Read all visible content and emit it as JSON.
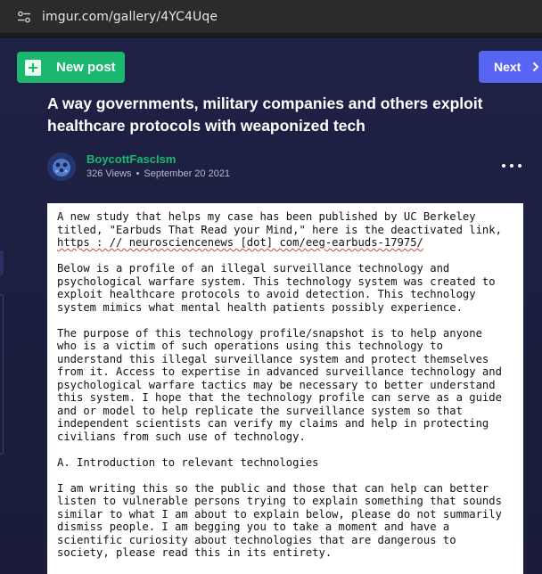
{
  "browser": {
    "url": "imgur.com/gallery/4YC4Uqe",
    "site_icon": "site-settings-icon"
  },
  "toolbar": {
    "new_post_label": "New post",
    "new_post_icon": "plus-icon",
    "next_label": "Next",
    "next_icon": "chevron-right-icon"
  },
  "post": {
    "title": "A way governments, military companies and others exploit healthcare protocols with weaponized tech",
    "author": "BoycottFascIsm",
    "views": "326 Views",
    "date": "September 20 2021",
    "more_icon": "more-options-icon"
  },
  "document": {
    "lines": [
      [
        "A new study that helps my case has been published by UC Berkeley",
        "titled, \"Earbuds That Read your Mind,\" here is the deactivated link,",
        "https : // neurosciencenews [dot] com/eeg-earbuds-17975/"
      ],
      [
        "Below is a profile of an illegal surveillance technology and",
        "psychological warfare system. This technology system was created to",
        "exploit healthcare protocols to avoid detection. This technology",
        "system mimics what mental health patients possibly experience."
      ],
      [
        "The purpose of this technology profile/snapshot is to help anyone",
        "who is a victim of such operations using this technology to",
        "understand this illegal surveillance system and protect themselves",
        "from it. Access to expertise in advanced surveillance technology and",
        "psychological warfare tactics may be necessary to better understand",
        "this system. I hope that the technology profile can serve as a guide",
        "and or model to help replicate the surveillance system so that",
        "independent scientists can verify my claims and help in protecting",
        "civilians from such use of technology."
      ],
      [
        "A. Introduction to relevant technologies"
      ],
      [
        "I am writing this so the public and those that can help can better",
        "listen to vulnerable persons trying to explain something that sounds",
        "similar to what I am about to explain below, please do not summarily",
        "dismiss people. I am begging you to take a moment and have a",
        "scientific curiosity about technologies that are dangerous to",
        "society, please read this in its entirety."
      ]
    ]
  },
  "colors": {
    "page_bg": "#1c1d3d",
    "new_post_green": "#1bb76e",
    "next_blue": "#5865f2",
    "author_green": "#1bb76e"
  }
}
